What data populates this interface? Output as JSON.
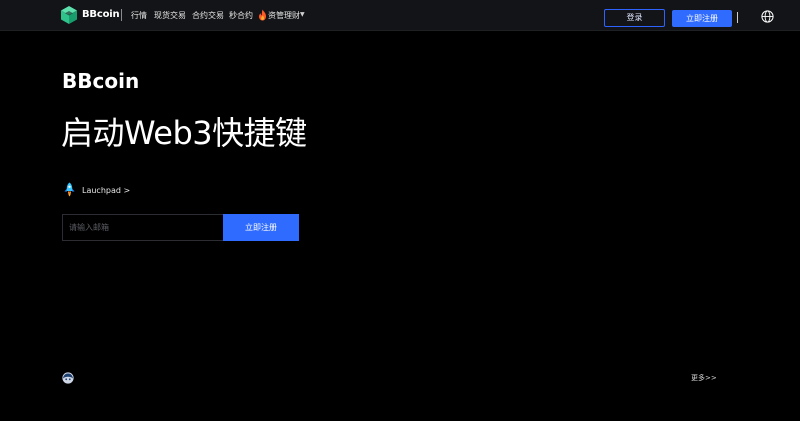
{
  "navbar": {
    "brand": "BBcoin",
    "links": [
      {
        "label": "行情"
      },
      {
        "label": "现货交易"
      },
      {
        "label": "合约交易"
      },
      {
        "label": "秒合约"
      },
      {
        "label": "资管理财"
      }
    ],
    "login_label": "登录",
    "register_label": "立即注册"
  },
  "hero": {
    "brand": "BBcoin",
    "title": "启动Web3快捷键",
    "launchpad_label": "Lauchpad >",
    "email_placeholder": "请输入邮箱",
    "register_label": "立即注册"
  },
  "footer": {
    "more_label": "更多>>"
  },
  "colors": {
    "background": "#000000",
    "navbar": "#131417",
    "accent": "#2f6bff",
    "logo_green": "#2fc28b"
  },
  "icons": [
    "cube-logo-icon",
    "fire-icon",
    "chevron-down-icon",
    "globe-icon",
    "rocket-icon",
    "avatar-icon"
  ]
}
